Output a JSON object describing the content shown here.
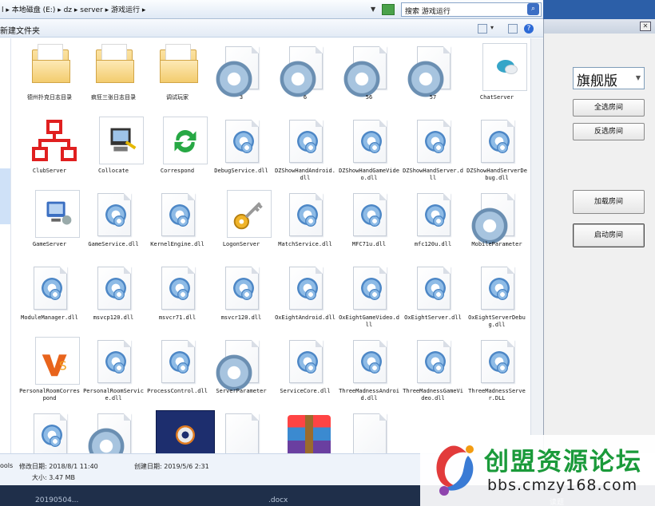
{
  "explorer": {
    "address": {
      "parts": [
        "本地磁盘 (E:)",
        "dz",
        "server",
        "游戏运行"
      ],
      "prefix": "l"
    },
    "search_placeholder": "搜索 游戏运行",
    "new_folder": "新建文件夹"
  },
  "files": [
    {
      "label": "德州扑克日志目录",
      "icon": "folder"
    },
    {
      "label": "疯狂三张日志目录",
      "icon": "folder"
    },
    {
      "label": "调试玩家",
      "icon": "folder"
    },
    {
      "label": "3",
      "icon": "gear-doc"
    },
    {
      "label": "6",
      "icon": "gear-doc"
    },
    {
      "label": "56",
      "icon": "gear-doc"
    },
    {
      "label": "57",
      "icon": "gear-doc"
    },
    {
      "label": "ChatServer",
      "icon": "chat-app"
    },
    {
      "label": "ClubServer",
      "icon": "network-app"
    },
    {
      "label": "Collocate",
      "icon": "app"
    },
    {
      "label": "Correspond",
      "icon": "app"
    },
    {
      "label": "DebugService.dll",
      "icon": "dll"
    },
    {
      "label": "DZShowHandAndroid.dll",
      "icon": "dll"
    },
    {
      "label": "DZShowHandGameVideo.dll",
      "icon": "dll"
    },
    {
      "label": "DZShowHandServer.dll",
      "icon": "dll"
    },
    {
      "label": "DZShowHandServerDebug.dll",
      "icon": "dll"
    },
    {
      "label": "GameServer",
      "icon": "app"
    },
    {
      "label": "GameService.dll",
      "icon": "dll"
    },
    {
      "label": "KernelEngine.dll",
      "icon": "dll"
    },
    {
      "label": "LogonServer",
      "icon": "key-app"
    },
    {
      "label": "MatchService.dll",
      "icon": "dll"
    },
    {
      "label": "MFC71u.dll",
      "icon": "dll"
    },
    {
      "label": "mfc120u.dll",
      "icon": "dll"
    },
    {
      "label": "MobileParameter",
      "icon": "gear-doc"
    },
    {
      "label": "ModuleManager.dll",
      "icon": "dll"
    },
    {
      "label": "msvcp120.dll",
      "icon": "dll"
    },
    {
      "label": "msvcr71.dll",
      "icon": "dll"
    },
    {
      "label": "msvcr120.dll",
      "icon": "dll"
    },
    {
      "label": "OxEightAndroid.dll",
      "icon": "dll"
    },
    {
      "label": "OxEightGameVideo.dll",
      "icon": "dll"
    },
    {
      "label": "OxEightServer.dll",
      "icon": "dll"
    },
    {
      "label": "OxEightServerDebug.dll",
      "icon": "dll"
    },
    {
      "label": "PersonalRoomCorrespond",
      "icon": "app"
    },
    {
      "label": "PersonalRoomService.dll",
      "icon": "dll"
    },
    {
      "label": "ProcessControl.dll",
      "icon": "dll"
    },
    {
      "label": "ServerParameter",
      "icon": "gear-doc"
    },
    {
      "label": "ServiceCore.dll",
      "icon": "dll"
    },
    {
      "label": "ThreeMadnessAndroid.dll",
      "icon": "dll"
    },
    {
      "label": "ThreeMadnessGameVideo.dll",
      "icon": "dll"
    },
    {
      "label": "ThreeMadnessServer.DLL",
      "icon": "dll"
    },
    {
      "label": "",
      "icon": "dll"
    },
    {
      "label": "",
      "icon": "gear-doc"
    },
    {
      "label": "",
      "icon": "gear-app"
    },
    {
      "label": "",
      "icon": "blank-doc"
    },
    {
      "label": "",
      "icon": "winrar"
    },
    {
      "label": "",
      "icon": "blank-doc"
    }
  ],
  "details": {
    "name_fragment": "ools",
    "modified": "修改日期: 2018/8/1 11:40",
    "created": "创建日期: 2019/5/6 2:31",
    "size": "大小: 3.47 MB"
  },
  "taskbar": {
    "left_text": "20190504...",
    "mid_text": ".docx",
    "right_text": "读题"
  },
  "panel": {
    "edition": "旗舰版",
    "select_all": "全选房间",
    "invert_select": "反选房间",
    "load_rooms": "加载房间",
    "start_rooms": "启动房间"
  },
  "watermark": {
    "name": "创盟资源论坛",
    "url": "bbs.cmzy168.com"
  },
  "colors": {
    "accent": "#2c5fa8",
    "watermark_green": "#1a9a3a"
  }
}
